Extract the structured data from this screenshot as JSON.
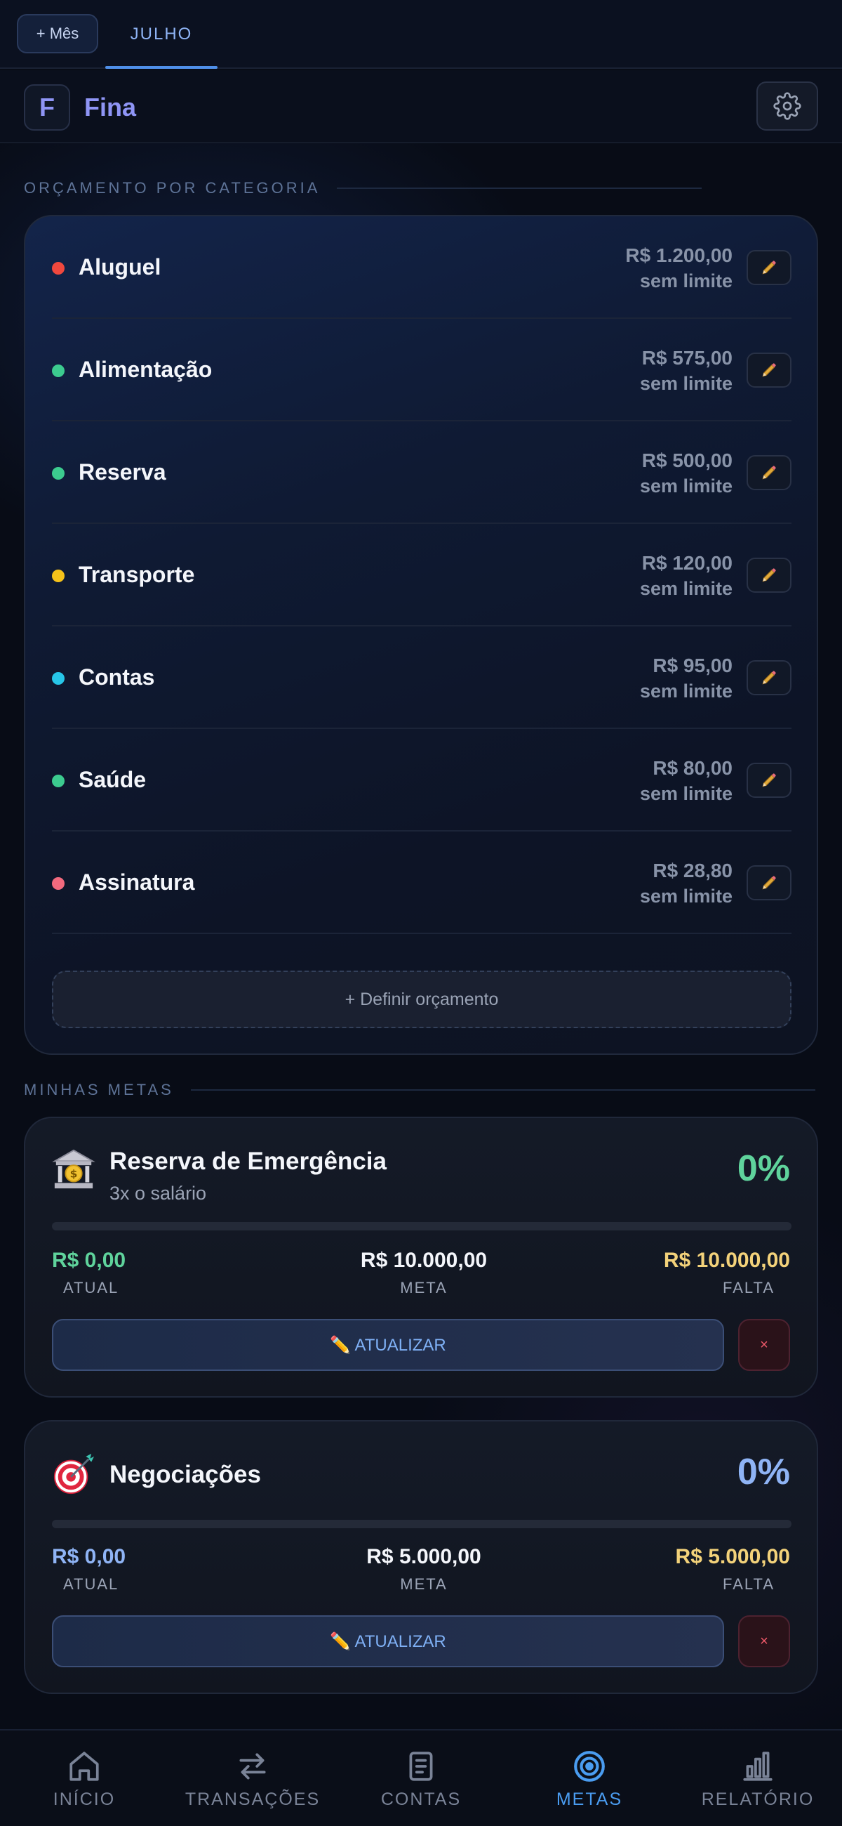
{
  "month_bar": {
    "add_month_label": "+ Mês",
    "current_month": "JULHO"
  },
  "header": {
    "logo_letter": "F",
    "app_name": "Fina",
    "settings_icon": "gear-icon"
  },
  "budget": {
    "section_title": "ORÇAMENTO POR CATEGORIA",
    "categories": [
      {
        "name": "Aluguel",
        "amount": "R$ 1.200,00",
        "limit": "sem limite",
        "color": "#f0483e"
      },
      {
        "name": "Alimentação",
        "amount": "R$ 575,00",
        "limit": "sem limite",
        "color": "#3ccb8f"
      },
      {
        "name": "Reserva",
        "amount": "R$ 500,00",
        "limit": "sem limite",
        "color": "#3ccb8f"
      },
      {
        "name": "Transporte",
        "amount": "R$ 120,00",
        "limit": "sem limite",
        "color": "#f5c21a"
      },
      {
        "name": "Contas",
        "amount": "R$ 95,00",
        "limit": "sem limite",
        "color": "#27c6e8"
      },
      {
        "name": "Saúde",
        "amount": "R$ 80,00",
        "limit": "sem limite",
        "color": "#3ccb8f"
      },
      {
        "name": "Assinatura",
        "amount": "R$ 28,80",
        "limit": "sem limite",
        "color": "#f26a7e"
      }
    ],
    "define_button": "+ Definir orçamento"
  },
  "goals": {
    "section_title": "MINHAS METAS",
    "items": [
      {
        "icon": "bank-icon",
        "title": "Reserva de Emergência",
        "subtitle": "3x o salário",
        "percent": "0%",
        "percent_color": "#5fd39c",
        "progress": 0,
        "current_value": "R$ 0,00",
        "current_label": "ATUAL",
        "current_color": "#5fd39c",
        "target_value": "R$ 10.000,00",
        "target_label": "META",
        "remaining_value": "R$ 10.000,00",
        "remaining_label": "FALTA",
        "update_button": "✏️ ATUALIZAR",
        "delete_button": "×"
      },
      {
        "icon": "target-icon",
        "title": "Negociações",
        "subtitle": "",
        "percent": "0%",
        "percent_color": "#8fb4f5",
        "progress": 0,
        "current_value": "R$ 0,00",
        "current_label": "ATUAL",
        "current_color": "#8fb4f5",
        "target_value": "R$ 5.000,00",
        "target_label": "META",
        "remaining_value": "R$ 5.000,00",
        "remaining_label": "FALTA",
        "update_button": "✏️ ATUALIZAR",
        "delete_button": "×"
      }
    ]
  },
  "nav": {
    "items": [
      {
        "label": "INÍCIO",
        "icon": "home-icon",
        "active": false
      },
      {
        "label": "TRANSAÇÕES",
        "icon": "transfer-icon",
        "active": false
      },
      {
        "label": "CONTAS",
        "icon": "document-icon",
        "active": false
      },
      {
        "label": "METAS",
        "icon": "target-icon",
        "active": true
      },
      {
        "label": "RELATÓRIO",
        "icon": "bar-chart-icon",
        "active": false
      }
    ]
  },
  "colors": {
    "accent": "#4a9cf0",
    "brand": "#8f95f5",
    "remaining": "#f3d27a"
  }
}
